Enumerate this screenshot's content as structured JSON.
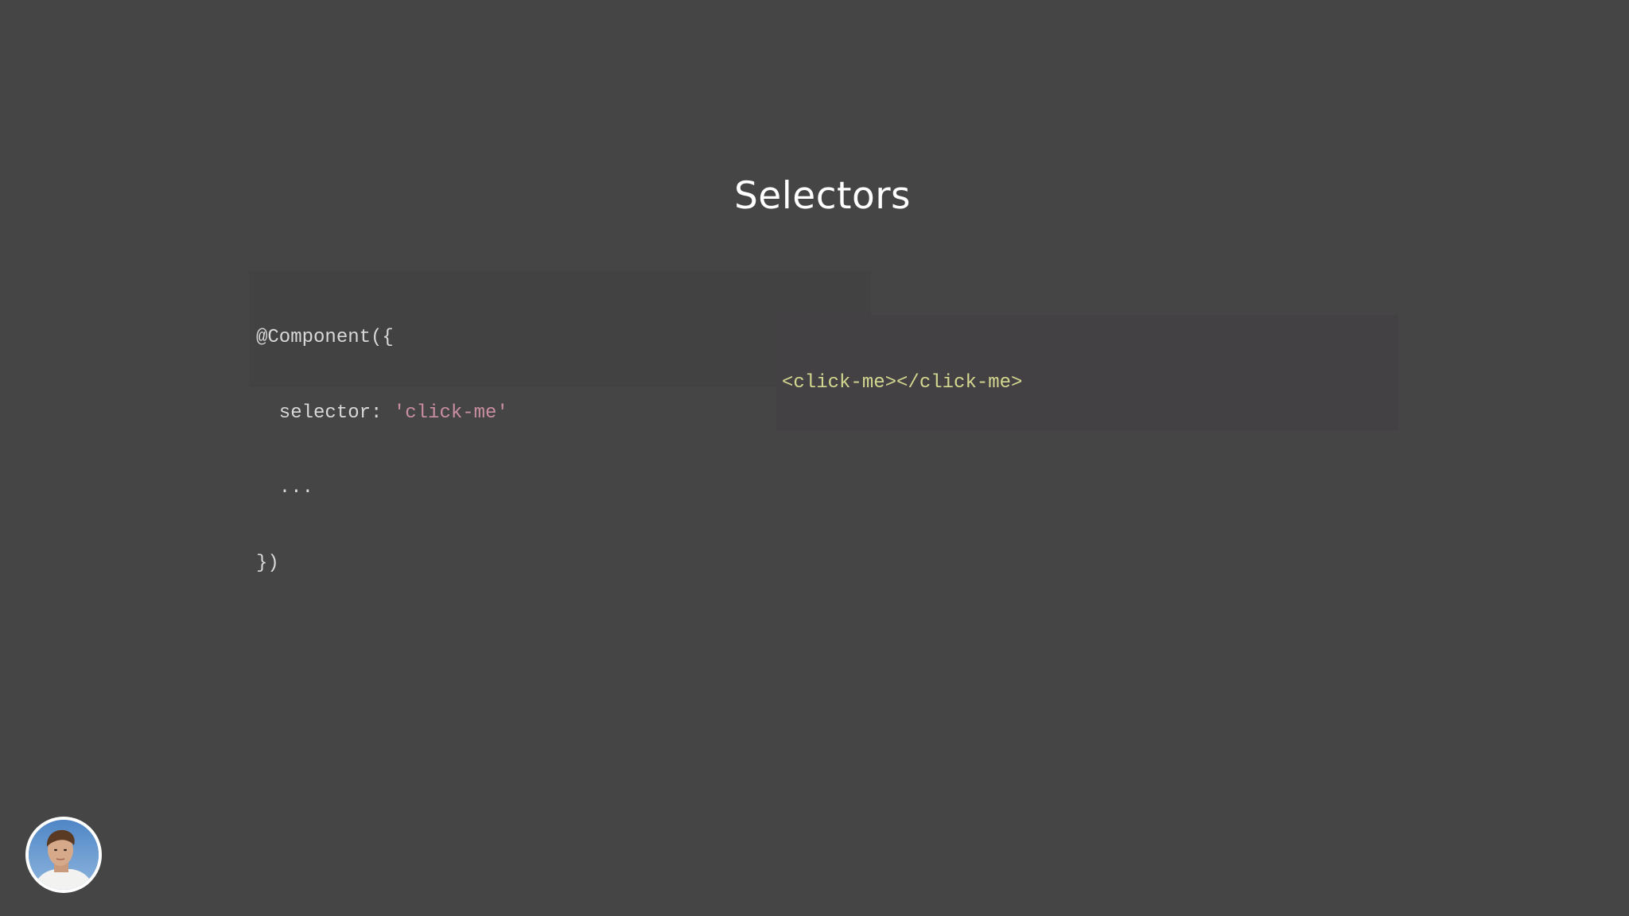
{
  "slide": {
    "title": "Selectors"
  },
  "code_left": {
    "lines": [
      {
        "plain": "@Component({",
        "string": ""
      },
      {
        "plain": "  selector: ",
        "string": "'click-me'"
      },
      {
        "plain": "  ...",
        "string": ""
      },
      {
        "plain": "})",
        "string": ""
      }
    ]
  },
  "code_right": {
    "open_tag": "<click-me>",
    "close_tag": "</click-me>"
  },
  "colors": {
    "background": "#464546",
    "code_background": "#434243",
    "string": "#c98ea0",
    "tag": "#d3d78f",
    "text": "#d8d8d8",
    "title": "#ffffff"
  },
  "avatar": {
    "icon": "presenter-avatar"
  }
}
